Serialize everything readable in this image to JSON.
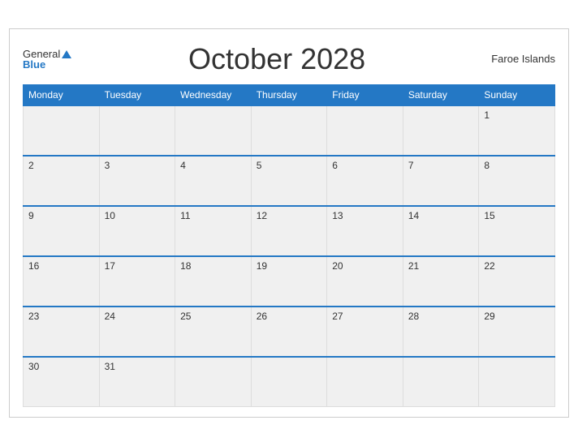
{
  "header": {
    "logo_general": "General",
    "logo_blue": "Blue",
    "title": "October 2028",
    "region": "Faroe Islands"
  },
  "days_of_week": [
    "Monday",
    "Tuesday",
    "Wednesday",
    "Thursday",
    "Friday",
    "Saturday",
    "Sunday"
  ],
  "weeks": [
    [
      "",
      "",
      "",
      "",
      "",
      "",
      "1"
    ],
    [
      "2",
      "3",
      "4",
      "5",
      "6",
      "7",
      "8"
    ],
    [
      "9",
      "10",
      "11",
      "12",
      "13",
      "14",
      "15"
    ],
    [
      "16",
      "17",
      "18",
      "19",
      "20",
      "21",
      "22"
    ],
    [
      "23",
      "24",
      "25",
      "26",
      "27",
      "28",
      "29"
    ],
    [
      "30",
      "31",
      "",
      "",
      "",
      "",
      ""
    ]
  ]
}
